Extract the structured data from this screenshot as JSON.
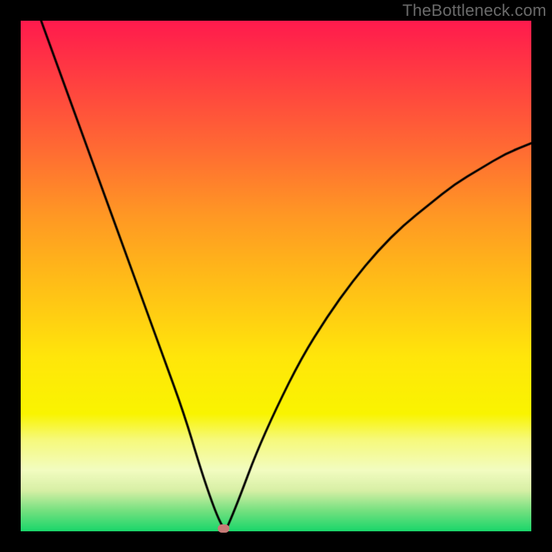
{
  "watermark": "TheBottleneck.com",
  "chart_data": {
    "type": "line",
    "title": "",
    "xlabel": "",
    "ylabel": "",
    "xlim": [
      0,
      100
    ],
    "ylim": [
      0,
      100
    ],
    "grid": false,
    "series": [
      {
        "name": "curve",
        "x": [
          4,
          8,
          12,
          16,
          20,
          24,
          28,
          32,
          35,
          37,
          38.5,
          39.5,
          40,
          41,
          43,
          46,
          50,
          55,
          60,
          65,
          70,
          75,
          80,
          85,
          90,
          95,
          100
        ],
        "values": [
          100,
          89,
          78,
          67,
          56,
          45,
          34,
          23,
          13,
          7,
          3,
          1,
          0,
          2,
          7,
          15,
          24,
          34,
          42,
          49,
          55,
          60,
          64,
          68,
          71,
          74,
          76
        ]
      }
    ],
    "marker": {
      "x": 39.7,
      "y": 0.6,
      "color": "#c77b77"
    },
    "gradient_stops": [
      {
        "pos": 0.0,
        "color": "#ff1a4d"
      },
      {
        "pos": 0.12,
        "color": "#ff4040"
      },
      {
        "pos": 0.25,
        "color": "#ff6a33"
      },
      {
        "pos": 0.38,
        "color": "#ff9724"
      },
      {
        "pos": 0.48,
        "color": "#ffb41a"
      },
      {
        "pos": 0.58,
        "color": "#ffcf12"
      },
      {
        "pos": 0.66,
        "color": "#ffe60a"
      },
      {
        "pos": 0.77,
        "color": "#f9f400"
      },
      {
        "pos": 0.82,
        "color": "#f6f97a"
      },
      {
        "pos": 0.88,
        "color": "#f2fcc0"
      },
      {
        "pos": 0.92,
        "color": "#d7efa5"
      },
      {
        "pos": 0.96,
        "color": "#73e07f"
      },
      {
        "pos": 1.0,
        "color": "#19d66a"
      }
    ]
  }
}
